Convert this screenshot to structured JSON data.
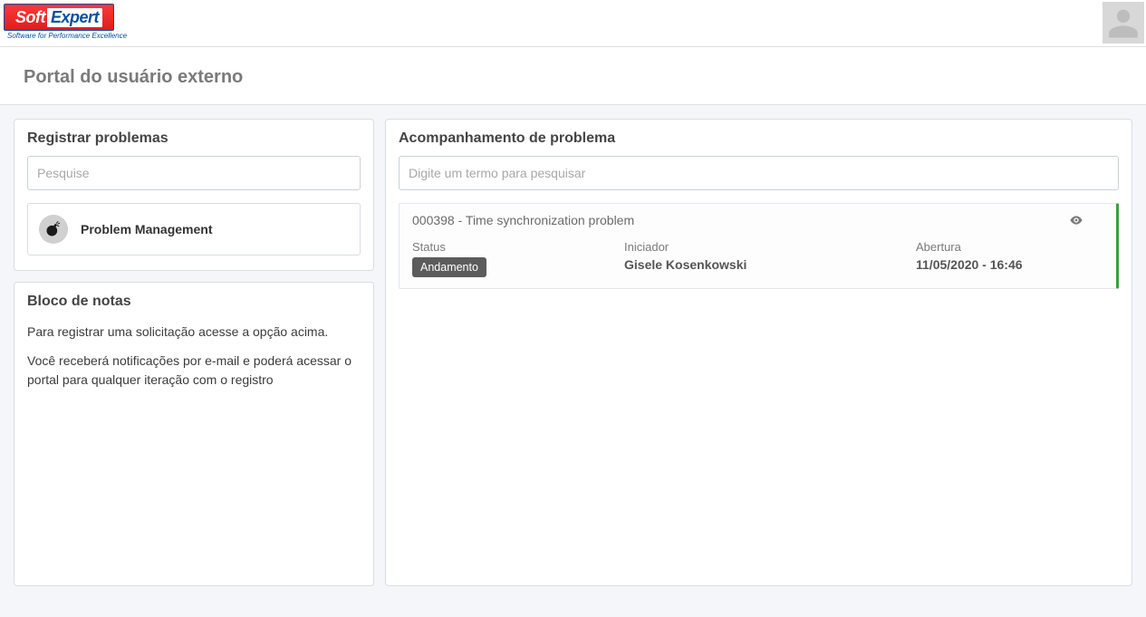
{
  "header": {
    "logo_soft": "Soft",
    "logo_expert": "Expert",
    "logo_tagline": "Software for Performance Excellence"
  },
  "page_title": "Portal do usuário externo",
  "register": {
    "title": "Registrar problemas",
    "search_placeholder": "Pesquise",
    "category_label": "Problem Management"
  },
  "notes": {
    "title": "Bloco de notas",
    "line1": "Para registrar uma solicitação acesse a opção acima.",
    "line2": "Você receberá notificações por e-mail e poderá acessar o portal para qualquer iteração com o registro"
  },
  "tracking": {
    "title": "Acompanhamento de problema",
    "search_placeholder": "Digite um termo para pesquisar",
    "card": {
      "title": "000398 - Time synchronization problem",
      "status_label": "Status",
      "status_value": "Andamento",
      "initiator_label": "Iniciador",
      "initiator_value": "Gisele Kosenkowski",
      "opened_label": "Abertura",
      "opened_value": "11/05/2020 - 16:46"
    }
  }
}
